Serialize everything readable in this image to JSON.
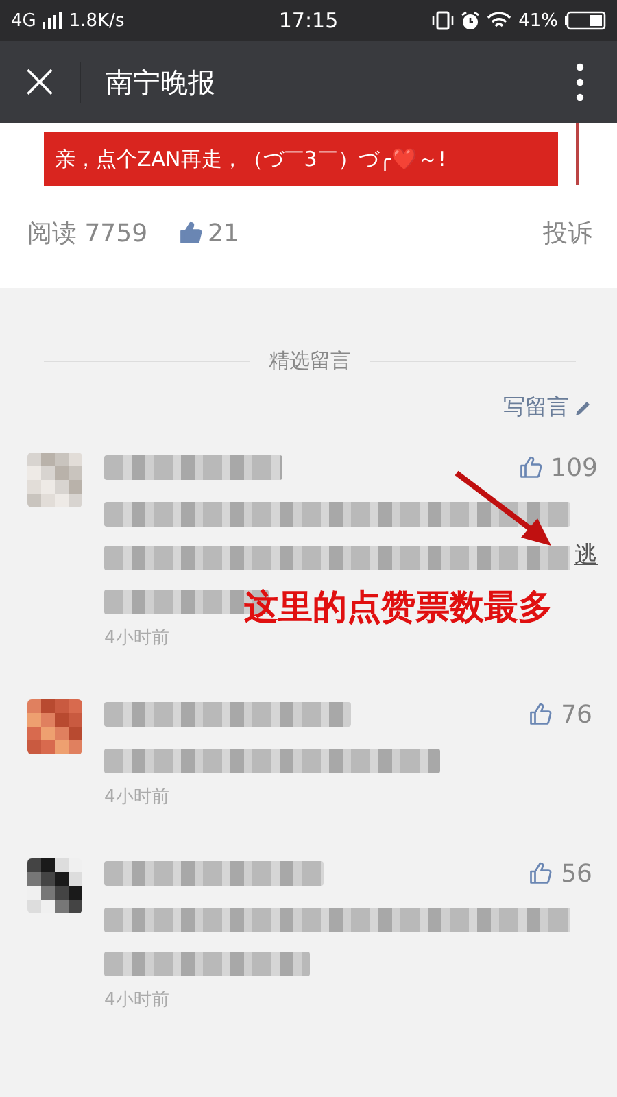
{
  "status_bar": {
    "network": "4G",
    "speed": "1.8K/s",
    "time": "17:15",
    "battery": "41%"
  },
  "nav_bar": {
    "close": "×",
    "title": "南宁晚报"
  },
  "banner": {
    "text": "亲，点个ZAN再走，（づ￣3￣）づ╭❤️～!"
  },
  "stats": {
    "reads": "阅读 7759",
    "likes": "21",
    "report": "投诉"
  },
  "comments_section": {
    "heading": "精选留言",
    "write": "写留言"
  },
  "comments": [
    {
      "kind": "picture",
      "likes": "109",
      "tail_text": "逃",
      "time": "4小时前"
    },
    {
      "kind": "picture",
      "likes": "76",
      "time": "4小时前"
    },
    {
      "kind": "picture",
      "likes": "56",
      "time": "4小时前"
    }
  ],
  "annotation": {
    "text": "这里的点赞票数最多"
  }
}
